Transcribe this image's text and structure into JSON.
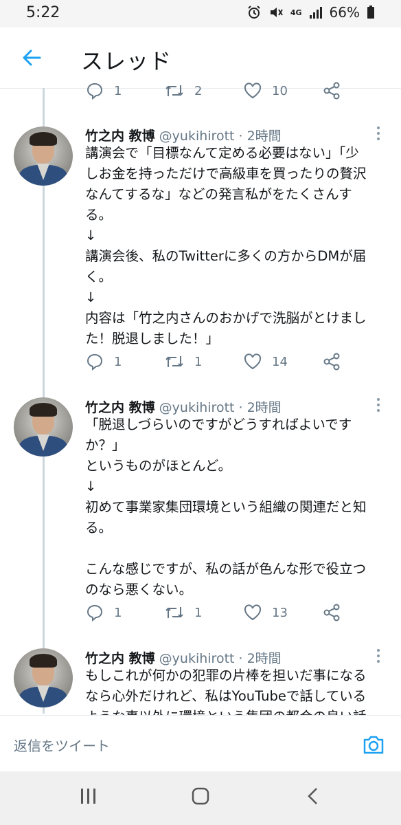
{
  "status_bar": {
    "time": "5:22",
    "network": "4G",
    "battery": "66%",
    "icons": [
      "alarm-icon",
      "mute-icon",
      "signal-icon",
      "battery-icon"
    ]
  },
  "header": {
    "back_icon": "arrow-left-icon",
    "title": "スレッド"
  },
  "previous_tweet_actions": {
    "reply_count": "1",
    "retweet_count": "2",
    "like_count": "10"
  },
  "tweets": [
    {
      "author": "竹之内 教博",
      "meta": "@yukihirott · 2時間",
      "lines": [
        "講演会で「目標なんて定める必要はない」「少",
        "しお金を持っただけで高級車を買ったりの贅沢",
        "なんてするな」などの発言私がをたくさんす",
        "る。",
        "↓",
        "講演会後、私のTwitterに多くの方からDMが届",
        "く。",
        "↓",
        "内容は「竹之内さんのおかげで洗脳がとけまし",
        "た！脱退しました！」"
      ],
      "reply_count": "1",
      "retweet_count": "1",
      "like_count": "14"
    },
    {
      "author": "竹之内 教博",
      "meta": "@yukihirott · 2時間",
      "lines": [
        "「脱退しづらいのですがどうすればよいです",
        "か？」",
        "というものがほとんど。",
        "↓",
        "初めて事業家集団環境という組織の関連だと知",
        "る。",
        "",
        "こんな感じですが、私の話が色んな形で役立つ",
        "のなら悪くない。"
      ],
      "reply_count": "1",
      "retweet_count": "1",
      "like_count": "13"
    },
    {
      "author": "竹之内 教博",
      "meta": "@yukihirott · 2時間",
      "lines": [
        "もしこれが何かの犯罪の片棒を担いだ事になる",
        "なら心外だけれど、私はYouTubeで話している",
        "ような事以外に環境という集団の都合の良い話"
      ]
    }
  ],
  "reply_bar": {
    "placeholder": "返信をツイート",
    "camera_icon": "camera-icon"
  },
  "nav_bar": {
    "icons": [
      "recent-apps-icon",
      "home-icon",
      "back-icon"
    ]
  },
  "colors": {
    "accent": "#1da1f2",
    "secondary_text": "#657786",
    "thread_line": "#ccd6dd"
  }
}
